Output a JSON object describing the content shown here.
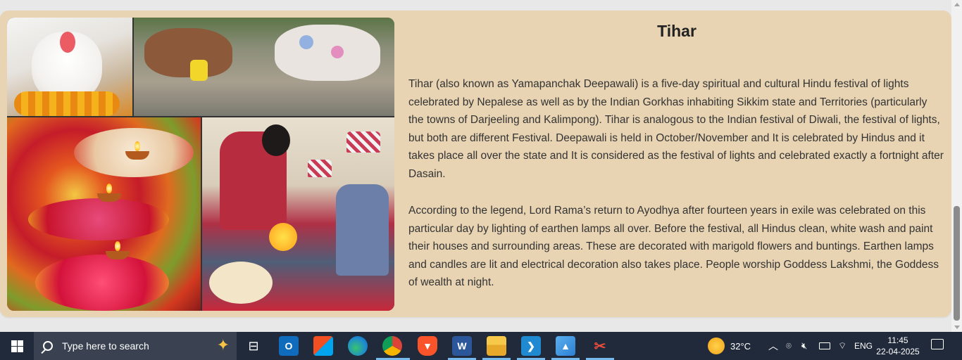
{
  "article": {
    "title": "Tihar",
    "paragraph1": "Tihar (also known as Yamapanchak Deepawali) is a five-day spiritual and cultural Hindu festival of lights celebrated by Nepalese as well as by the Indian Gorkhas inhabiting Sikkim state and Territories (particularly the towns of Darjeeling and Kalimpong). Tihar is analogous to the Indian festival of Diwali, the festival of lights, but both are different Festival. Deepawali is held in October/November and It is celebrated by Hindus and it takes place all over the state and It is considered as the festival of lights and celebrated exactly a fortnight after Dasain.",
    "paragraph2": "According to the legend, Lord Rama’s return to Ayodhya after fourteen years in exile was celebrated on this particular day by lighting of earthen lamps all over. Before the festival, all Hindus clean, white wash and paint their houses and surrounding areas. These are decorated with marigold flowers and buntings. Earthen lamps and candles are lit and electrical decoration also takes place. People worship Goddess Lakshmi, the Goddess of wealth at night."
  },
  "colors": {
    "card_bg": "#e8d4b3",
    "page_bg": "#e9e8e8",
    "taskbar_bg": "#202a3a",
    "text": "#333333"
  },
  "taskbar": {
    "search_placeholder": "Type here to search",
    "pinned": [
      {
        "name": "task-view-icon"
      },
      {
        "name": "outlook-icon"
      },
      {
        "name": "microsoft-store-icon"
      },
      {
        "name": "edge-icon"
      },
      {
        "name": "chrome-icon"
      },
      {
        "name": "brave-icon"
      },
      {
        "name": "word-icon"
      },
      {
        "name": "file-explorer-icon"
      },
      {
        "name": "vscode-icon"
      },
      {
        "name": "photos-icon"
      },
      {
        "name": "snipping-tool-icon"
      }
    ],
    "weather": "32°C",
    "language": "ENG",
    "time": "11:45",
    "date": "22-04-2025"
  }
}
